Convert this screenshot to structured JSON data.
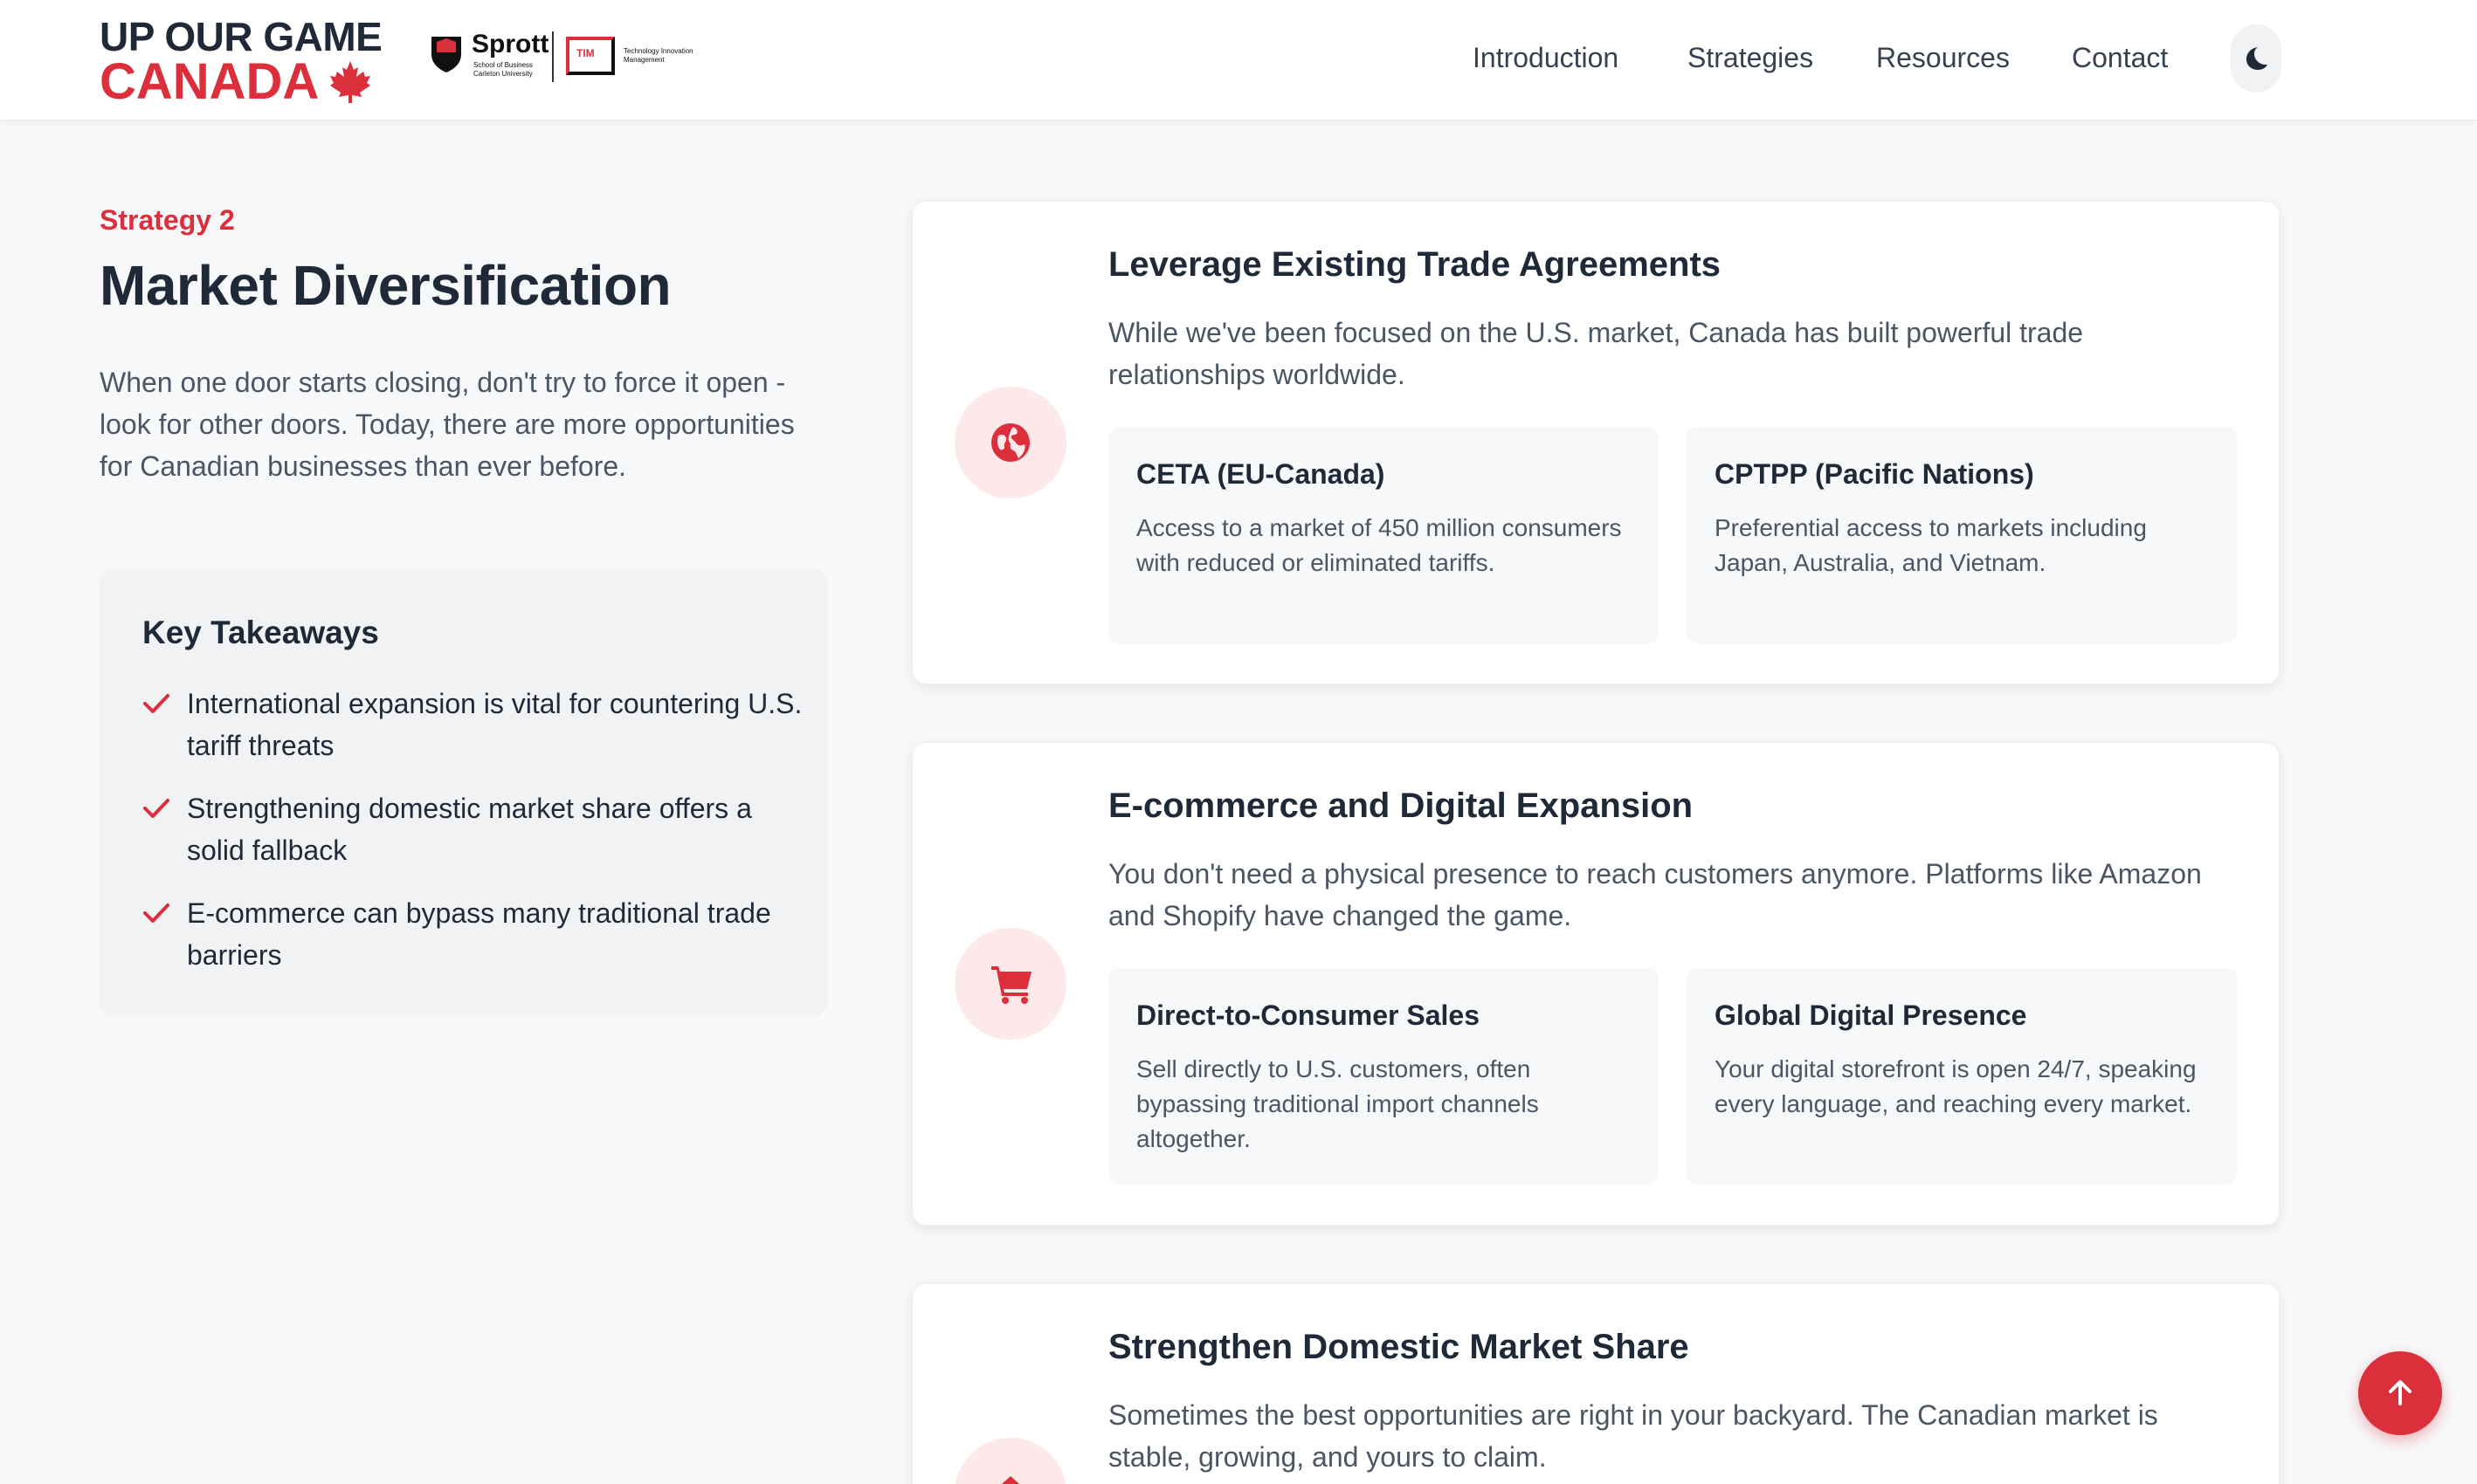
{
  "brand": {
    "line1": "UP OUR GAME",
    "line2": "CANADA",
    "partner_name": "Sprott",
    "partner_sub1": "School of Business",
    "partner_sub2": "Carleton University",
    "tim_label": "TIM",
    "tim_sub1": "Technology Innovation",
    "tim_sub2": "Management"
  },
  "nav": {
    "items": [
      "Introduction",
      "Strategies",
      "Resources",
      "Contact"
    ],
    "theme_toggle_icon": "moon-icon"
  },
  "section": {
    "eyebrow": "Strategy 2",
    "title": "Market Diversification",
    "intro": "When one door starts closing, don't try to force it open - look for other doors. Today, there are more opportunities for Canadian businesses than ever before."
  },
  "takeaways": {
    "heading": "Key Takeaways",
    "items": [
      "International expansion is vital for countering U.S. tariff threats",
      "Strengthening domestic market share offers a solid fallback",
      "E-commerce can bypass many traditional trade barriers"
    ]
  },
  "cards": [
    {
      "icon": "globe-icon",
      "title": "Leverage Existing Trade Agreements",
      "description": "While we've been focused on the U.S. market, Canada has built powerful trade relationships worldwide.",
      "subs": [
        {
          "title": "CETA (EU-Canada)",
          "text": "Access to a market of 450 million consumers with reduced or eliminated tariffs."
        },
        {
          "title": "CPTPP (Pacific Nations)",
          "text": "Preferential access to markets including Japan, Australia, and Vietnam."
        }
      ]
    },
    {
      "icon": "shopping-cart-icon",
      "title": "E-commerce and Digital Expansion",
      "description": "You don't need a physical presence to reach customers anymore. Platforms like Amazon and Shopify have changed the game.",
      "subs": [
        {
          "title": "Direct-to-Consumer Sales",
          "text": "Sell directly to U.S. customers, often bypassing traditional import channels altogether."
        },
        {
          "title": "Global Digital Presence",
          "text": "Your digital storefront is open 24/7, speaking every language, and reaching every market."
        }
      ]
    },
    {
      "icon": "home-icon",
      "title": "Strengthen Domestic Market Share",
      "description": "Sometimes the best opportunities are right in your backyard. The Canadian market is stable, growing, and yours to claim."
    }
  ],
  "scroll_top_icon": "arrow-up-icon",
  "colors": {
    "accent": "#dc2f3c",
    "accent_soft": "#fde8ea",
    "text": "#1f2937",
    "muted": "#4b5563",
    "background": "#f7f8fa"
  }
}
